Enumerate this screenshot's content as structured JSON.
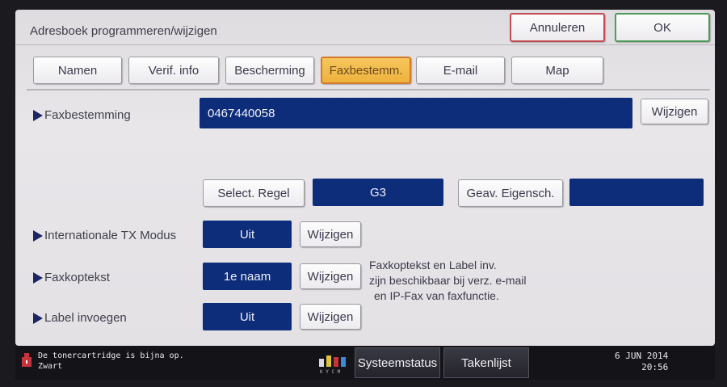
{
  "window": {
    "title": "Adresboek programmeren/wijzigen"
  },
  "actions": {
    "cancel_label": "Annuleren",
    "ok_label": "OK"
  },
  "tabs": [
    {
      "label": "Namen"
    },
    {
      "label": "Verif. info"
    },
    {
      "label": "Bescherming"
    },
    {
      "label": "Faxbestemm.",
      "active": true
    },
    {
      "label": "E-mail"
    },
    {
      "label": "Map"
    }
  ],
  "fax_destination": {
    "label": "Faxbestemming",
    "value": "0467440058",
    "change_label": "Wijzigen"
  },
  "line_select": {
    "button_label": "Select. Regel",
    "value": "G3",
    "advanced_label": "Geav. Eigensch.",
    "advanced_value": ""
  },
  "international_tx": {
    "label": "Internationale TX Modus",
    "value": "Uit",
    "change_label": "Wijzigen"
  },
  "fax_header": {
    "label": "Faxkoptekst",
    "value": "1e naam",
    "change_label": "Wijzigen"
  },
  "insert_label": {
    "label": "Label invoegen",
    "value": "Uit",
    "change_label": "Wijzigen"
  },
  "info_note": [
    "Faxkoptekst en Label inv.",
    "zijn beschikbaar bij verz. e-mail",
    "en IP-Fax van faxfunctie."
  ],
  "status_bar": {
    "toner_message": "De tonercartridge is bijna op.",
    "toner_color": "Zwart",
    "system_status_label": "Systeemstatus",
    "job_list_label": "Takenlijst",
    "date": "6  JUN  2014",
    "time": "20:56"
  },
  "colors": {
    "field_blue": "#0d2c7a",
    "tab_active": "#f0b84a",
    "cancel_border": "#c44a52",
    "ok_border": "#4d9b56"
  },
  "icons": {
    "toner": "toner-warning-icon",
    "system": "kycm-toner-levels-icon"
  }
}
